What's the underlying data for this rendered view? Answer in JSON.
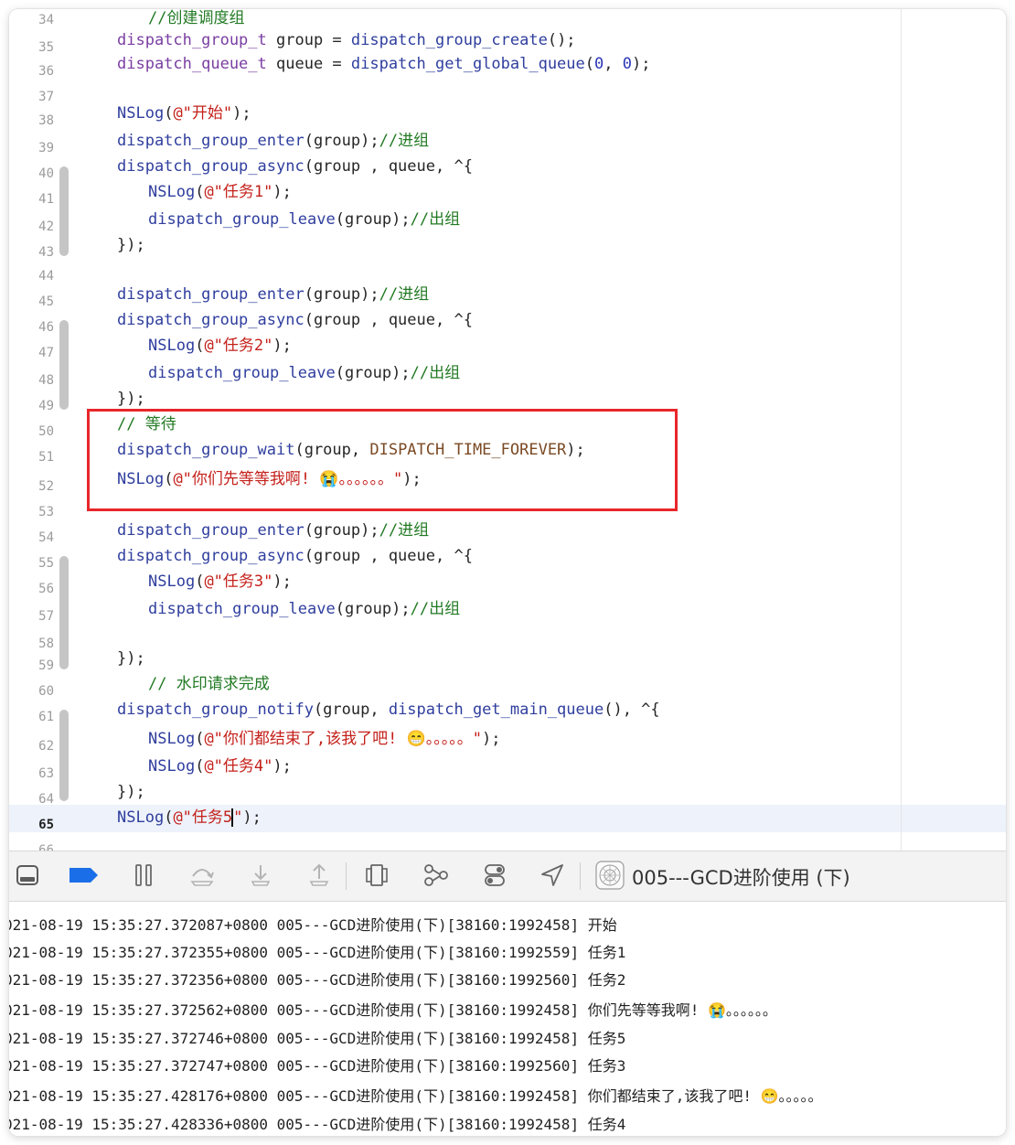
{
  "editor": {
    "partial_top_line_number": "34",
    "partial_top_comment": "//创建调度组",
    "partial_bottom_line_number": "66",
    "line_numbers": [
      "35",
      "36",
      "37",
      "38",
      "39",
      "40",
      "41",
      "42",
      "43",
      "44",
      "45",
      "46",
      "47",
      "48",
      "49",
      "50",
      "51",
      "52",
      "53",
      "54",
      "55",
      "56",
      "57",
      "58",
      "59",
      "60",
      "61",
      "62",
      "63",
      "64",
      "65"
    ],
    "current_line": "65",
    "line35": {
      "type": "dispatch_group_t",
      "var": " group = ",
      "fn": "dispatch_group_create",
      "rest": "();"
    },
    "line36": {
      "type": "dispatch_queue_t",
      "var": " queue = ",
      "fn": "dispatch_get_global_queue",
      "open": "(",
      "n1": "0",
      ", ": ", ",
      "n2": "0",
      "close": ");"
    },
    "line38": {
      "fn": "NSLog",
      "open": "(",
      "str": "@\"开始\"",
      "close": ");"
    },
    "line39": {
      "fn": "dispatch_group_enter",
      "args": "(group);",
      "cm": "//进组"
    },
    "line40": {
      "fn": "dispatch_group_async",
      "args": "(group , queue, ^{"
    },
    "line41": {
      "fn": "NSLog",
      "open": "(",
      "str": "@\"任务1\"",
      "close": ");"
    },
    "line42": {
      "fn": "dispatch_group_leave",
      "args": "(group);",
      "cm": "//出组"
    },
    "line43": {
      "text": "});"
    },
    "line45": {
      "fn": "dispatch_group_enter",
      "args": "(group);",
      "cm": "//进组"
    },
    "line46": {
      "fn": "dispatch_group_async",
      "args": "(group , queue, ^{"
    },
    "line47": {
      "fn": "NSLog",
      "open": "(",
      "str": "@\"任务2\"",
      "close": ");"
    },
    "line48": {
      "fn": "dispatch_group_leave",
      "args": "(group);",
      "cm": "//出组"
    },
    "line49": {
      "text": "});"
    },
    "line50": {
      "cm": "// 等待"
    },
    "line51": {
      "fn": "dispatch_group_wait",
      "args": "(group, ",
      "macro": "DISPATCH_TIME_FOREVER",
      "close": ");"
    },
    "line52": {
      "fn": "NSLog",
      "open": "(",
      "str": "@\"你们先等等我啊! 😭。。。。。。\"",
      "close": ");"
    },
    "line54": {
      "fn": "dispatch_group_enter",
      "args": "(group);",
      "cm": "//进组"
    },
    "line55": {
      "fn": "dispatch_group_async",
      "args": "(group , queue, ^{"
    },
    "line56": {
      "fn": "NSLog",
      "open": "(",
      "str": "@\"任务3\"",
      "close": ");"
    },
    "line57": {
      "fn": "dispatch_group_leave",
      "args": "(group);",
      "cm": "//出组"
    },
    "line59": {
      "text": "});"
    },
    "line60": {
      "cm": "// 水印请求完成"
    },
    "line61": {
      "fn": "dispatch_group_notify",
      "args": "(group, ",
      "fn2": "dispatch_get_main_queue",
      "rest": "(), ^{"
    },
    "line62": {
      "fn": "NSLog",
      "open": "(",
      "str": "@\"你们都结束了,该我了吧! 😁。。。。。\"",
      "close": ");"
    },
    "line63": {
      "fn": "NSLog",
      "open": "(",
      "str": "@\"任务4\"",
      "close": ");"
    },
    "line64": {
      "text": "});"
    },
    "line65": {
      "fn": "NSLog",
      "open": "(",
      "str_a": "@\"任务5",
      "str_b": "\"",
      "close": ");"
    }
  },
  "debug_bar": {
    "target_name": "005---GCD进阶使用 (下)",
    "icons": [
      "hide-debug-area-icon",
      "breakpoint-toggle-icon",
      "pause-icon",
      "step-over-icon",
      "step-into-icon",
      "step-out-icon",
      "view-hierarchy-icon",
      "memory-graph-icon",
      "environment-overrides-icon",
      "simulate-location-icon",
      "app-target-icon"
    ],
    "accent": "#1a6fe8"
  },
  "console": {
    "lines": [
      "021-08-19 15:35:27.372087+0800 005---GCD进阶使用(下)[38160:1992458] 开始",
      "021-08-19 15:35:27.372355+0800 005---GCD进阶使用(下)[38160:1992559] 任务1",
      "021-08-19 15:35:27.372356+0800 005---GCD进阶使用(下)[38160:1992560] 任务2",
      "021-08-19 15:35:27.372562+0800 005---GCD进阶使用(下)[38160:1992458] 你们先等等我啊! 😭。。。。。。",
      "021-08-19 15:35:27.372746+0800 005---GCD进阶使用(下)[38160:1992458] 任务5",
      "021-08-19 15:35:27.372747+0800 005---GCD进阶使用(下)[38160:1992560] 任务3",
      "021-08-19 15:35:27.428176+0800 005---GCD进阶使用(下)[38160:1992458] 你们都结束了,该我了吧! 😁。。。。。",
      "021-08-19 15:35:27.428336+0800 005---GCD进阶使用(下)[38160:1992458] 任务4"
    ]
  }
}
